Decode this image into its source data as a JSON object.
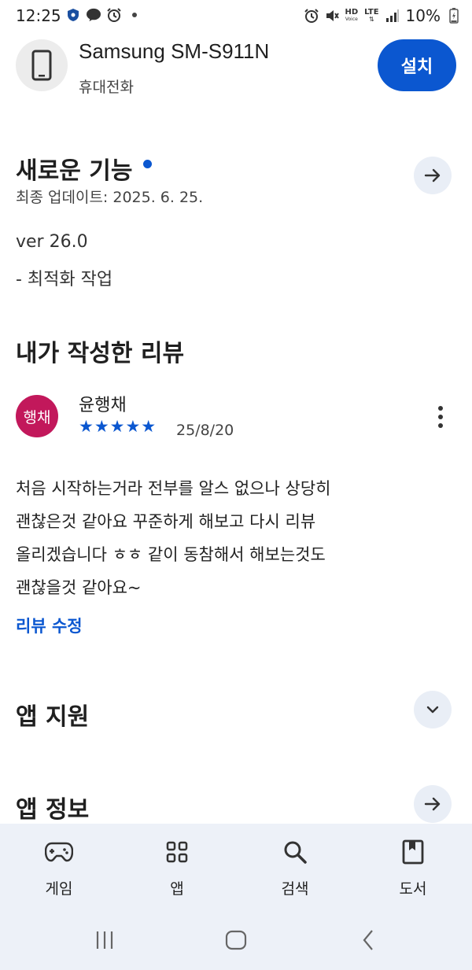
{
  "status_bar": {
    "time": "12:25",
    "battery": "10%",
    "network_hd": "HD",
    "network_voice": "Voice",
    "network_lte": "LTE",
    "left_icons": [
      "shield-icon",
      "talk-icon",
      "alarm-icon",
      "dot-icon"
    ],
    "right_icons": [
      "alarm-icon",
      "mute-icon",
      "hd-voice-icon",
      "lte-icon",
      "signal-icon",
      "battery-icon"
    ]
  },
  "app": {
    "title": "Samsung SM-S911N",
    "subtitle": "휴대전화",
    "install_label": "설치",
    "accent_color": "#0b57d0"
  },
  "whats_new": {
    "title": "새로운 기능",
    "last_updated": "최종 업데이트: 2025. 6. 25.",
    "version": "ver 26.0",
    "changes": "- 최적화 작업"
  },
  "my_review": {
    "section_title": "내가 작성한 리뷰",
    "avatar_text": "행채",
    "avatar_color": "#c2185b",
    "reviewer_name": "윤행채",
    "stars": "★★★★★",
    "rating": 5,
    "date": "25/8/20",
    "text_lines": [
      "처음 시작하는거라 전부를 알스 없으나 상당히",
      "괜찮은것 같아요 꾸준하게 해보고 다시 리뷰",
      "올리겠습니다 ㅎㅎ 같이 동참해서  해보는것도",
      "괜찮을것 같아요~"
    ],
    "edit_label": "리뷰 수정"
  },
  "app_support": {
    "title": "앱 지원"
  },
  "app_info": {
    "title": "앱 정보"
  },
  "bottom_nav": [
    {
      "label": "게임",
      "icon": "gamepad-icon"
    },
    {
      "label": "앱",
      "icon": "apps-grid-icon"
    },
    {
      "label": "검색",
      "icon": "search-icon"
    },
    {
      "label": "도서",
      "icon": "book-icon"
    }
  ],
  "system_nav": [
    "recents-icon",
    "home-icon",
    "back-icon"
  ]
}
